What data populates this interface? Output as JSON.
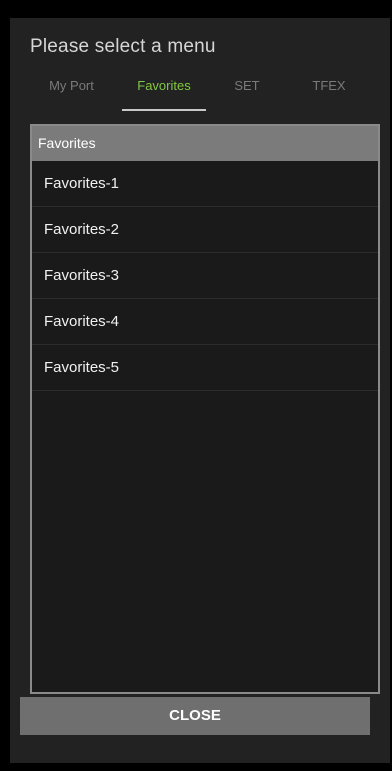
{
  "dialog": {
    "title": "Please select a menu"
  },
  "tabs": [
    {
      "label": "My Port",
      "active": false
    },
    {
      "label": "Favorites",
      "active": true
    },
    {
      "label": "SET",
      "active": false
    },
    {
      "label": "TFEX",
      "active": false
    }
  ],
  "panel": {
    "header": "Favorites",
    "items": [
      {
        "label": "Favorites-1"
      },
      {
        "label": "Favorites-2"
      },
      {
        "label": "Favorites-3"
      },
      {
        "label": "Favorites-4"
      },
      {
        "label": "Favorites-5"
      }
    ]
  },
  "footer": {
    "close_label": "CLOSE"
  },
  "colors": {
    "active_tab": "#7ec845",
    "inactive_tab": "#7a7a7a",
    "dialog_bg": "#222222",
    "panel_header_bg": "#7b7b7b",
    "close_button_bg": "#6f6f6f"
  }
}
